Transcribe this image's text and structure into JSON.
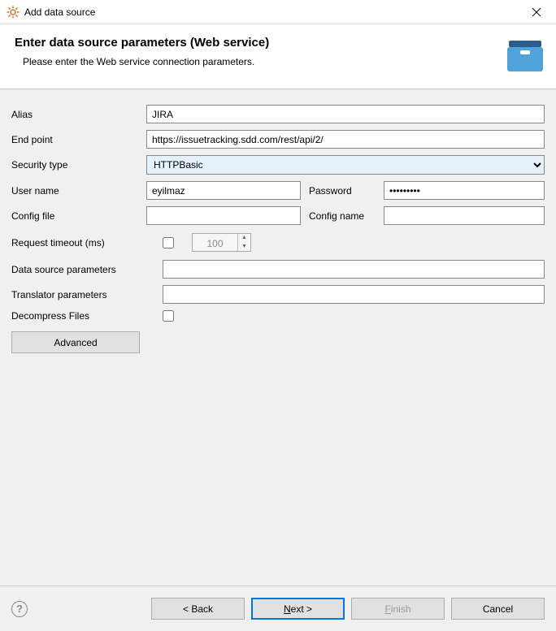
{
  "window": {
    "title": "Add data source"
  },
  "header": {
    "title": "Enter data source parameters (Web service)",
    "subtitle": "Please enter the Web service connection parameters."
  },
  "labels": {
    "alias": "Alias",
    "endpoint": "End point",
    "security_type": "Security type",
    "user_name": "User name",
    "password": "Password",
    "config_file": "Config file",
    "config_name": "Config name",
    "request_timeout": "Request timeout (ms)",
    "data_source_params": "Data source parameters",
    "translator_params": "Translator parameters",
    "decompress_files": "Decompress Files",
    "advanced": "Advanced"
  },
  "values": {
    "alias": "JIRA",
    "endpoint": "https://issuetracking.sdd.com/rest/api/2/",
    "security_type": "HTTPBasic",
    "user_name": "eyilmaz",
    "password": "•••••••••",
    "config_file": "",
    "config_name": "",
    "request_timeout_enabled": false,
    "request_timeout_value": "100",
    "data_source_params": "",
    "translator_params": "",
    "decompress_files": false
  },
  "footer": {
    "back": "< Back",
    "next_prefix": "N",
    "next_suffix": "ext >",
    "finish_prefix": "F",
    "finish_suffix": "inish",
    "cancel": "Cancel"
  }
}
